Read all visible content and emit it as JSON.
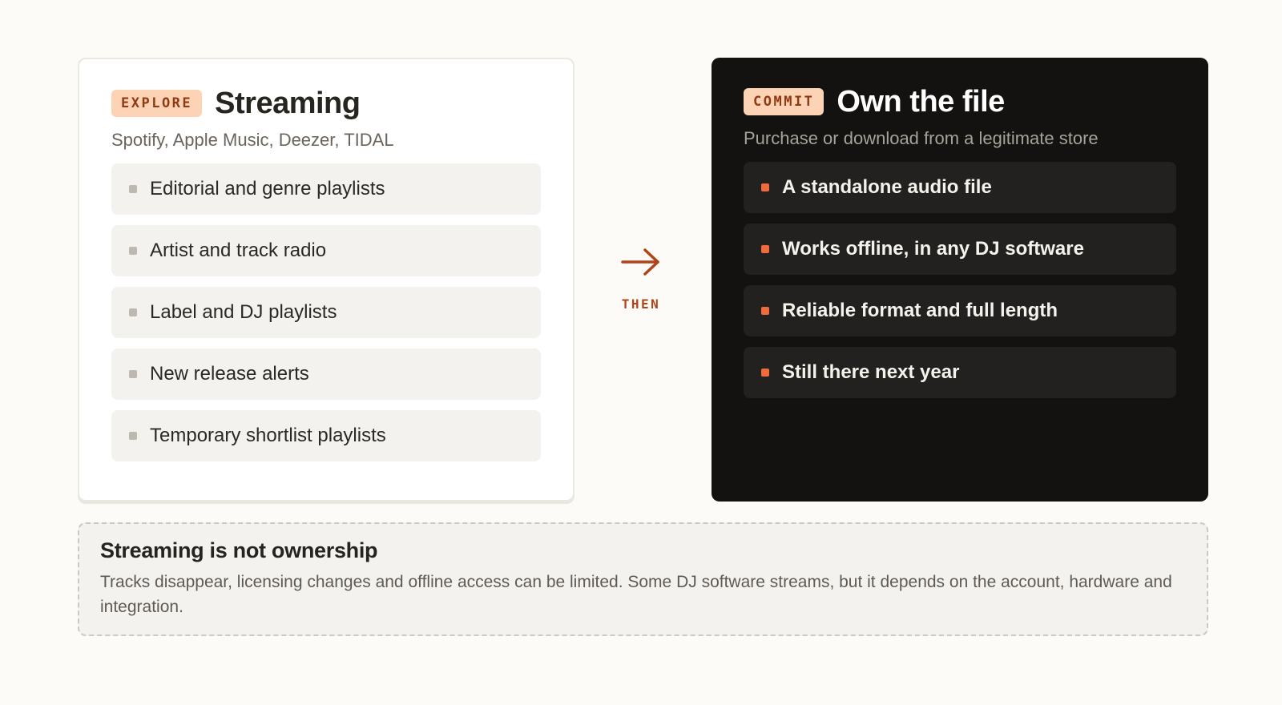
{
  "explore": {
    "badge": "EXPLORE",
    "title": "Streaming",
    "subtitle": "Spotify, Apple Music, Deezer, TIDAL",
    "items": [
      "Editorial and genre playlists",
      "Artist and track radio",
      "Label and DJ playlists",
      "New release alerts",
      "Temporary shortlist playlists"
    ]
  },
  "connector": {
    "label": "THEN",
    "icon": "arrow-right-icon"
  },
  "commit": {
    "badge": "COMMIT",
    "title": "Own the file",
    "subtitle": "Purchase or download from a legitimate store",
    "items": [
      "A standalone audio file",
      "Works offline, in any DJ software",
      "Reliable format and full length",
      "Still there next year"
    ]
  },
  "note": {
    "title": "Streaming is not ownership",
    "body": "Tracks disappear, licensing changes and offline access can be limited. Some DJ software streams, but it depends on the account, hardware and integration."
  },
  "colors": {
    "accent": "#ef6a3c",
    "badge_bg": "#fdd3b5",
    "dark_card": "#131210",
    "page_bg": "#fdfbf7"
  }
}
